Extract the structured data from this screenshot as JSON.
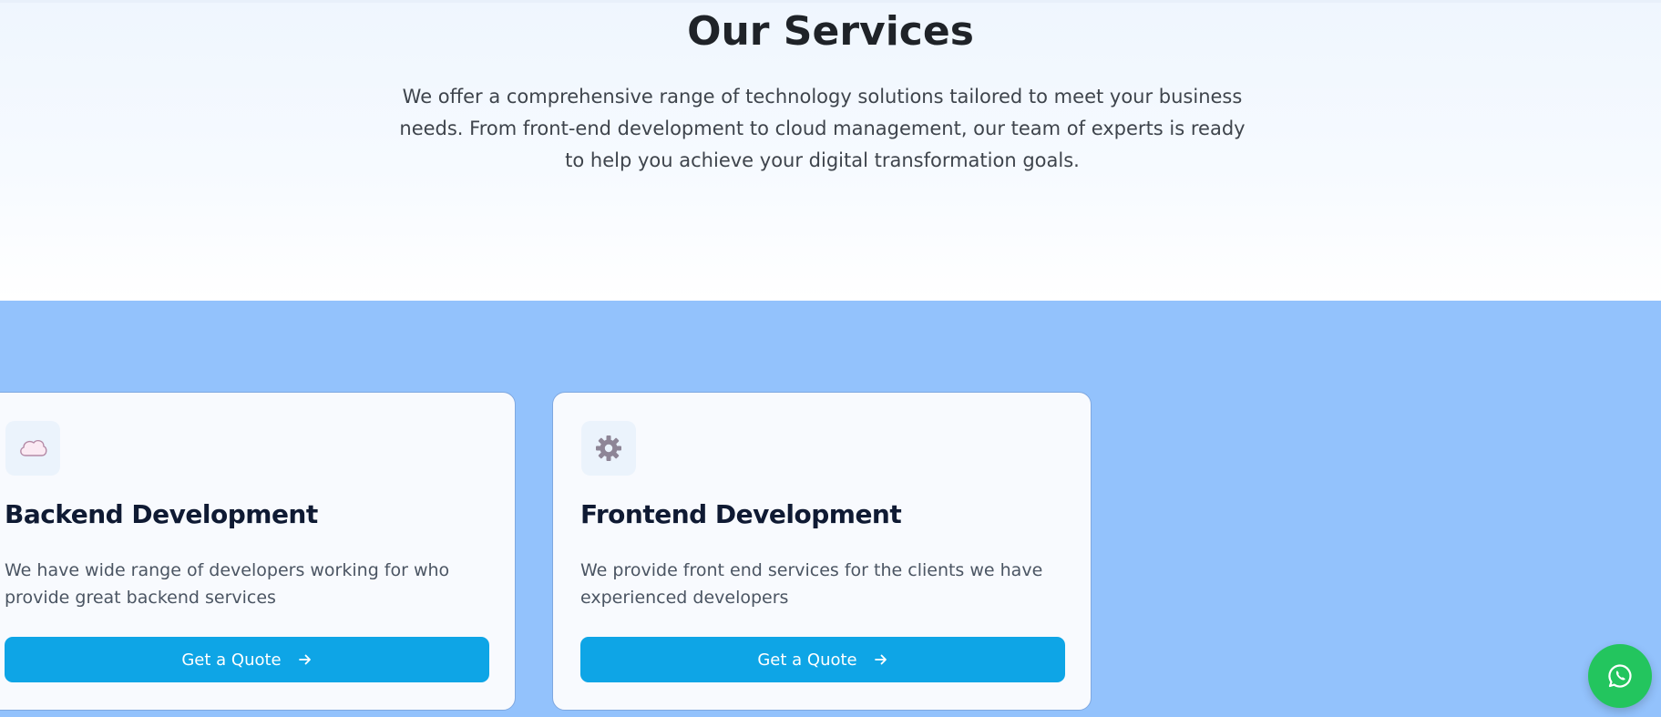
{
  "hero": {
    "title": "Our Services",
    "description": "We offer a comprehensive range of technology solutions tailored to meet your business needs. From front-end development to cloud management, our team of experts is ready to help you achieve your digital transformation goals."
  },
  "services": [
    {
      "icon": "cloud-icon",
      "title": "Backend Development",
      "description": "We have wide range of developers working for who provide great backend services",
      "button_label": "Get a Quote"
    },
    {
      "icon": "gear-icon",
      "title": "Frontend Development",
      "description": "We provide front end services for the clients we have experienced developers",
      "button_label": "Get a Quote"
    }
  ],
  "floating": {
    "icon": "whatsapp-icon"
  },
  "colors": {
    "services_background": "#93c2fc",
    "button": "#0ea5e6",
    "whatsapp": "#23c55e"
  }
}
